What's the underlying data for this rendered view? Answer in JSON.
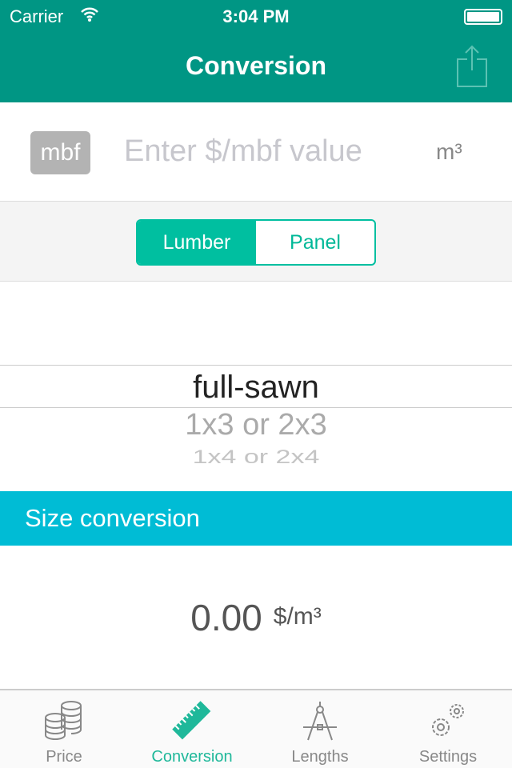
{
  "status": {
    "carrier": "Carrier",
    "time": "3:04 PM",
    "battery_percent": 100
  },
  "nav": {
    "title": "Conversion",
    "share_icon": "share-icon"
  },
  "input": {
    "unit_badge": "mbf",
    "placeholder": "Enter $/mbf value",
    "target_unit": "m³"
  },
  "segment": {
    "options": [
      "Lumber",
      "Panel"
    ],
    "selected": "Lumber"
  },
  "picker": {
    "items": [
      "full-sawn",
      "1x3 or 2x3",
      "1x4 or 2x4"
    ],
    "selected": "full-sawn"
  },
  "section": {
    "title": "Size conversion"
  },
  "result": {
    "value": "0.00",
    "unit": "$/m³"
  },
  "tabs": [
    {
      "label": "Price",
      "icon": "coins-icon"
    },
    {
      "label": "Conversion",
      "icon": "ruler-icon"
    },
    {
      "label": "Lengths",
      "icon": "compass-icon"
    },
    {
      "label": "Settings",
      "icon": "gears-icon"
    }
  ],
  "colors": {
    "header": "#009684",
    "accent": "#00bfa0",
    "section": "#00bcd5"
  }
}
